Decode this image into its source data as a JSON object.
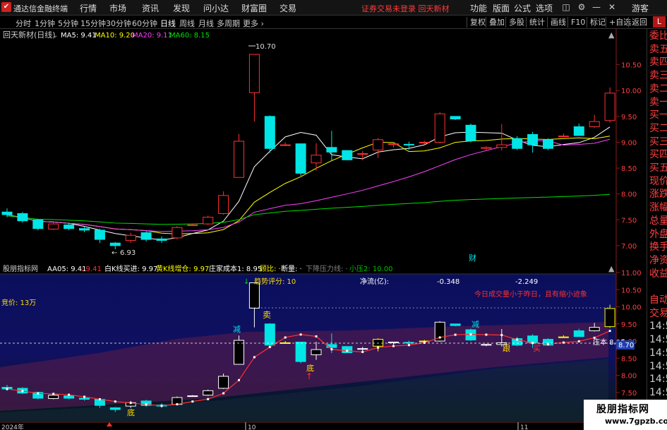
{
  "titlebar": {
    "app_title": "通达信金融终端",
    "menus": [
      "行情",
      "市场",
      "资讯",
      "发现",
      "问小达",
      "财富圈",
      "交易"
    ],
    "status": "证券交易未登录  回天新材",
    "right_menus": [
      "功能",
      "版面",
      "公式",
      "选项"
    ],
    "guest": "游客"
  },
  "periodbar": {
    "periods": [
      "分时",
      "1分钟",
      "5分钟",
      "15分钟",
      "30分钟",
      "60分钟",
      "日线",
      "周线",
      "月线",
      "多周期",
      "更多 ›"
    ],
    "active_period": "日线",
    "tools": [
      "复权",
      "叠加",
      "多股",
      "统计",
      "画线",
      "F10",
      "标记",
      "+自选",
      "返回"
    ],
    "l_badge": "L"
  },
  "main_chart": {
    "stock_label": "回天新材(日线)",
    "ma_labels": [
      {
        "text": "MA5: 9.41",
        "color": "#ffffff"
      },
      {
        "text": "MA10: 9.20",
        "color": "#ffff00"
      },
      {
        "text": "MA20: 9.11",
        "color": "#ff40ff"
      },
      {
        "text": "MA60: 8.15",
        "color": "#00e000"
      }
    ],
    "high_label": "10.70",
    "low_label": "6.93",
    "event_marker": "财",
    "price_ticks": [
      "10.50",
      "10.00",
      "9.50",
      "9.00",
      "8.50",
      "8.00",
      "7.50",
      "7.00"
    ]
  },
  "indicator": {
    "name": "股朋指标网",
    "header_items": [
      {
        "text": "AA05: 9.41",
        "color": "#ffffff"
      },
      {
        "text": ": 9.41",
        "color": "#ff3030"
      },
      {
        "text": "白K线买进: 9.97",
        "color": "#ffffff"
      },
      {
        "text": "黄K线增仓: 9.97",
        "color": "#ffff00"
      },
      {
        "text": "庄家成本1: 8.95",
        "color": "#ffffff"
      },
      {
        "text": "顾比: ·",
        "color": "#ffff00"
      },
      {
        "text": "断量: ·",
        "color": "#ffffff"
      },
      {
        "text": "下降压力线: ·",
        "color": "#808080"
      },
      {
        "text": "小压2: 10.00",
        "color": "#00c000"
      }
    ],
    "bid_label": "竞价: 13万",
    "trend_label": "趋势评分: 10",
    "net_flow_label": "净流(亿):",
    "net_flow_1": "-0.348",
    "net_flow_2": "-2.249",
    "volume_note": "今日成交量小于昨日，且有缩小迹象",
    "cost_label": "庄本 8.95",
    "cost_tag": "8.70",
    "markers": {
      "sell": "卖",
      "bottom": "底",
      "up": "↑",
      "reduce": "减",
      "follow": "跟",
      "buy": "买"
    },
    "ticks": [
      "11.00",
      "10.50",
      "10.00",
      "9.50",
      "9.00",
      "8.50",
      "8.00",
      "7.50",
      "7.00"
    ]
  },
  "date_axis": {
    "labels": [
      "2024年",
      "10",
      "11"
    ]
  },
  "sidebar": {
    "items": [
      "委比",
      "卖五",
      "卖四",
      "卖三",
      "卖二",
      "卖一",
      "买一",
      "买二",
      "买三",
      "买四",
      "买五",
      "现价",
      "涨跌",
      "涨幅",
      "总量",
      "外盘",
      "换手",
      "净资",
      "收益",
      "",
      "自动",
      "交易",
      "14:56",
      "14:56",
      "14:56",
      "14:56",
      "14:56",
      "14:56",
      "14:56",
      "14:56"
    ]
  },
  "watermark": {
    "line1": "股朋指标网",
    "line2": "www.7gpzb.com"
  },
  "colors": {
    "up": "#ff3030",
    "down": "#00e5e5",
    "ma5": "#ffffff",
    "ma10": "#ffff00",
    "ma20": "#ff40ff",
    "ma60": "#00e000"
  },
  "chart_data": {
    "type": "candlestick",
    "candles": [
      {
        "o": 7.65,
        "h": 7.72,
        "l": 7.55,
        "c": 7.6
      },
      {
        "o": 7.62,
        "h": 7.65,
        "l": 7.45,
        "c": 7.48
      },
      {
        "o": 7.5,
        "h": 7.52,
        "l": 7.3,
        "c": 7.33
      },
      {
        "o": 7.32,
        "h": 7.45,
        "l": 7.3,
        "c": 7.42
      },
      {
        "o": 7.4,
        "h": 7.44,
        "l": 7.3,
        "c": 7.33
      },
      {
        "o": 7.33,
        "h": 7.36,
        "l": 7.26,
        "c": 7.3
      },
      {
        "o": 7.3,
        "h": 7.33,
        "l": 7.05,
        "c": 7.12
      },
      {
        "o": 7.05,
        "h": 7.07,
        "l": 6.93,
        "c": 7.0
      },
      {
        "o": 7.1,
        "h": 7.25,
        "l": 7.05,
        "c": 7.2
      },
      {
        "o": 7.25,
        "h": 7.28,
        "l": 7.08,
        "c": 7.12
      },
      {
        "o": 7.13,
        "h": 7.18,
        "l": 7.05,
        "c": 7.1
      },
      {
        "o": 7.15,
        "h": 7.38,
        "l": 7.12,
        "c": 7.35
      },
      {
        "o": 7.4,
        "h": 7.42,
        "l": 7.38,
        "c": 7.4
      },
      {
        "o": 7.42,
        "h": 7.58,
        "l": 7.4,
        "c": 7.55
      },
      {
        "o": 7.62,
        "h": 8.05,
        "l": 7.6,
        "c": 7.97
      },
      {
        "o": 8.32,
        "h": 9.16,
        "l": 8.32,
        "c": 9.02
      },
      {
        "o": 9.96,
        "h": 10.7,
        "l": 9.4,
        "c": 10.7
      },
      {
        "o": 9.5,
        "h": 9.52,
        "l": 8.8,
        "c": 8.88
      },
      {
        "o": 8.95,
        "h": 9.0,
        "l": 8.93,
        "c": 8.95
      },
      {
        "o": 8.97,
        "h": 8.97,
        "l": 8.35,
        "c": 8.4
      },
      {
        "o": 8.6,
        "h": 8.98,
        "l": 8.45,
        "c": 8.75
      },
      {
        "o": 8.9,
        "h": 9.22,
        "l": 8.65,
        "c": 8.81
      },
      {
        "o": 8.84,
        "h": 8.84,
        "l": 8.65,
        "c": 8.66
      },
      {
        "o": 8.78,
        "h": 8.83,
        "l": 8.65,
        "c": 8.78
      },
      {
        "o": 8.85,
        "h": 9.08,
        "l": 8.7,
        "c": 9.05
      },
      {
        "o": 8.97,
        "h": 8.97,
        "l": 8.9,
        "c": 8.97
      },
      {
        "o": 8.96,
        "h": 9.01,
        "l": 8.85,
        "c": 8.95
      },
      {
        "o": 8.99,
        "h": 9.03,
        "l": 8.95,
        "c": 9.0
      },
      {
        "o": 9.0,
        "h": 9.58,
        "l": 8.98,
        "c": 9.55
      },
      {
        "o": 9.5,
        "h": 9.5,
        "l": 9.43,
        "c": 9.45
      },
      {
        "o": 9.33,
        "h": 9.36,
        "l": 9.0,
        "c": 9.03
      },
      {
        "o": 8.88,
        "h": 8.92,
        "l": 8.85,
        "c": 8.9
      },
      {
        "o": 8.9,
        "h": 9.35,
        "l": 8.84,
        "c": 8.95
      },
      {
        "o": 9.07,
        "h": 9.12,
        "l": 8.85,
        "c": 8.88
      },
      {
        "o": 9.15,
        "h": 9.2,
        "l": 8.8,
        "c": 8.95
      },
      {
        "o": 9.05,
        "h": 9.08,
        "l": 8.85,
        "c": 8.88
      },
      {
        "o": 9.12,
        "h": 9.17,
        "l": 9.1,
        "c": 9.12
      },
      {
        "o": 9.3,
        "h": 9.36,
        "l": 9.13,
        "c": 9.13
      },
      {
        "o": 9.3,
        "h": 9.53,
        "l": 9.28,
        "c": 9.4
      },
      {
        "o": 9.42,
        "h": 10.06,
        "l": 9.38,
        "c": 9.95
      }
    ]
  }
}
